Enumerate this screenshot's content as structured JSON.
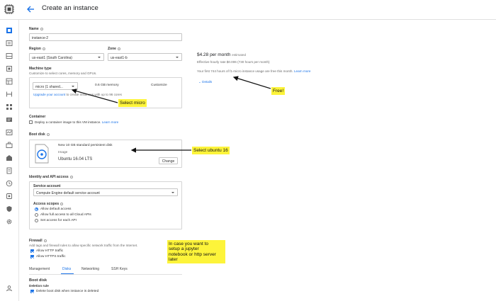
{
  "header": {
    "title": "Create an instance",
    "back_icon": "arrow-back-icon",
    "logo_icon": "chip-logo-icon"
  },
  "sidebar": {
    "items": [
      "compute-icon",
      "images-icon",
      "disk-icon",
      "snapshot-icon",
      "template-icon",
      "group-icon",
      "grid-icon",
      "metadata-icon",
      "health-icon",
      "zone-icon",
      "security-icon",
      "note-icon",
      "clock-icon",
      "settings-icon",
      "shield-icon",
      "gear-icon"
    ],
    "bottom_icon": "collapse-icon"
  },
  "form": {
    "name": {
      "label": "Name",
      "value": "instance-2"
    },
    "region": {
      "label": "Region",
      "value": "us-east1 (South Carolina)"
    },
    "zone": {
      "label": "Zone",
      "value": "us-east1-b"
    },
    "machine_type": {
      "label": "Machine type",
      "help": "Customize to select cores, memory and GPUs.",
      "select_value": "micro (1 shared...",
      "memory": "0.6 GB memory",
      "customize": "Customize",
      "upgrade_link": "Upgrade your account",
      "upgrade_rest": " to create instances with up to 96 cores"
    },
    "container": {
      "label": "Container",
      "checkbox_text": "Deploy a container image to this VM instance.",
      "learn_more": "Learn more"
    },
    "boot_disk": {
      "label": "Boot disk",
      "disk_name": "New 10 GB standard persistent disk",
      "image_label": "Image",
      "image_value": "Ubuntu 16.04 LTS",
      "change": "Change"
    },
    "identity": {
      "label": "Identity and API access",
      "service_account_label": "Service account",
      "service_account_value": "Compute Engine default service account",
      "access_scopes_label": "Access scopes",
      "scopes": [
        "Allow default access",
        "Allow full access to all Cloud APIs",
        "Set access for each API"
      ]
    },
    "firewall": {
      "label": "Firewall",
      "help": "Add tags and firewall rules to allow specific network traffic from the Internet.",
      "http": "Allow HTTP traffic",
      "https": "Allow HTTPS traffic"
    },
    "tabs": [
      "Management",
      "Disks",
      "Networking",
      "SSH Keys"
    ],
    "disks_section": {
      "title": "Boot disk",
      "deletion_rule_label": "Deletion rule",
      "delete_text": "Delete boot disk when instance is deleted"
    }
  },
  "pricing": {
    "price": "$4.28 per month",
    "estimated": "estimated",
    "hourly": "Effective hourly rate $0.006 (730 hours per month)",
    "free_text": "Your first 744 hours of f1-micro instance usage are free this month.",
    "learn_more": "Learn more",
    "details": "Details"
  },
  "annotations": {
    "select_micro": "Select micro",
    "free": "Free!",
    "select_ubuntu": "Select ubuntu 16",
    "jupyter": [
      "In case you want to",
      "setup a jupyter",
      "notebook or http server",
      "later"
    ]
  },
  "colors": {
    "accent": "#1a73e8",
    "note_yellow": "#fdf43a",
    "sidebar_active": "#1a73e8"
  }
}
